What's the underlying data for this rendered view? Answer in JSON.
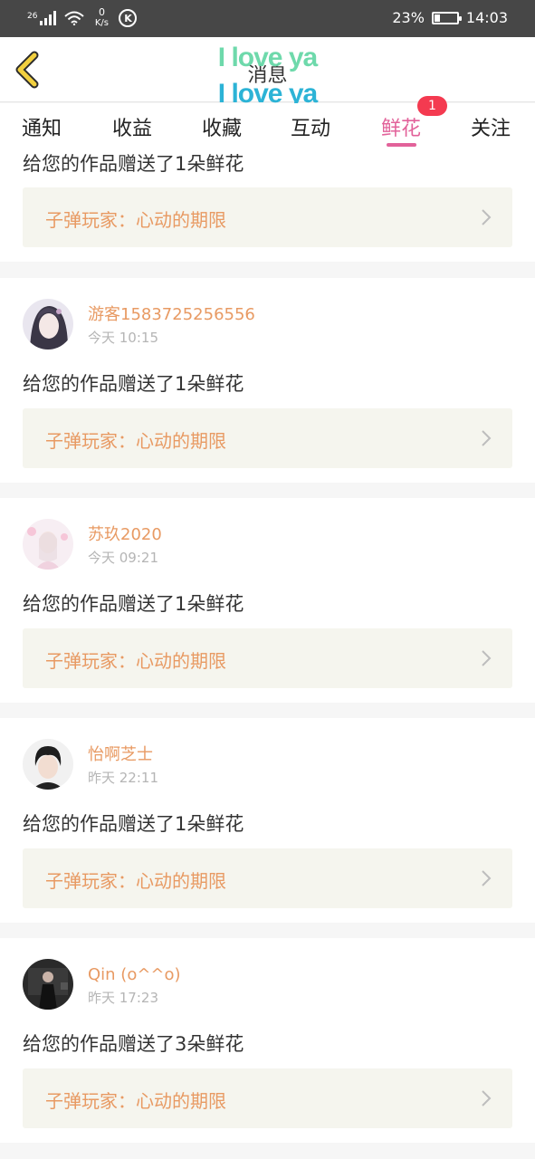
{
  "status_bar": {
    "network": "26",
    "speed_value": "0",
    "speed_unit": "K/s",
    "app_badge": "K",
    "battery_level": 0.23,
    "battery_percent": "23%",
    "time": "14:03"
  },
  "header": {
    "title": "消息",
    "overlay_line1": "I love ya",
    "overlay_line2": "I love ya",
    "back_icon": "chevron-left-icon"
  },
  "tabs": {
    "items": [
      "通知",
      "收益",
      "收藏",
      "互动",
      "鲜花",
      "关注"
    ],
    "active": "鲜花",
    "flower_badge": "1"
  },
  "colors": {
    "accent_pink": "#e2629a",
    "name_orange": "#e89a63",
    "badge_red": "#f43a50",
    "back_yellow": "#f2d03f"
  },
  "feed": {
    "top_partial_message": "给您的作品赠送了1朵鲜花",
    "top_partial_work": "子弹玩家：心动的期限",
    "items": [
      {
        "username": "游客1583725256556",
        "time": "今天 10:15",
        "message": "给您的作品赠送了1朵鲜花",
        "work": "子弹玩家：心动的期限"
      },
      {
        "username": "苏玖2020",
        "time": "今天 09:21",
        "message": "给您的作品赠送了1朵鲜花",
        "work": "子弹玩家：心动的期限"
      },
      {
        "username": "怡啊芝士",
        "time": "昨天 22:11",
        "message": "给您的作品赠送了1朵鲜花",
        "work": "子弹玩家：心动的期限"
      },
      {
        "username": "Qin (o^^o)",
        "time": "昨天 17:23",
        "message": "给您的作品赠送了3朵鲜花",
        "work": "子弹玩家：心动的期限"
      }
    ]
  }
}
